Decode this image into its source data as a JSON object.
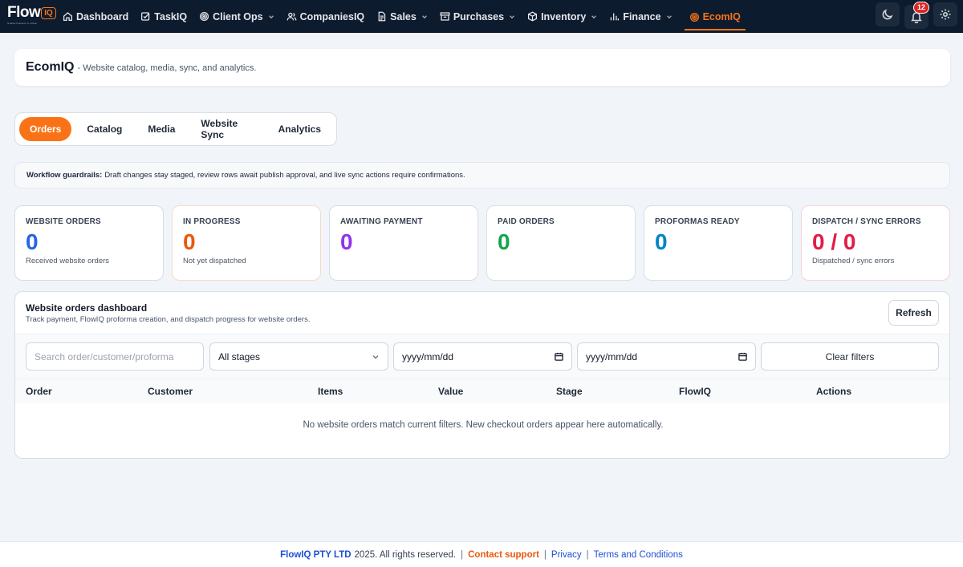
{
  "brand": {
    "word": "Flow",
    "suffix": "IQ",
    "tagline": "Smarter business, in motion"
  },
  "nav": {
    "items": [
      {
        "label": "Dashboard",
        "icon": "home-icon",
        "dropdown": false
      },
      {
        "label": "TaskIQ",
        "icon": "checkbox-icon",
        "dropdown": false
      },
      {
        "label": "Client Ops",
        "icon": "target-icon",
        "dropdown": true
      },
      {
        "label": "CompaniesIQ",
        "icon": "users-icon",
        "dropdown": false
      },
      {
        "label": "Sales",
        "icon": "document-icon",
        "dropdown": true
      },
      {
        "label": "Purchases",
        "icon": "archive-icon",
        "dropdown": true
      },
      {
        "label": "Inventory",
        "icon": "package-icon",
        "dropdown": true
      },
      {
        "label": "Finance",
        "icon": "bar-chart-icon",
        "dropdown": true
      },
      {
        "label": "EcomIQ",
        "icon": "target-icon",
        "dropdown": false,
        "active": true
      }
    ],
    "notifications_count": "12",
    "accent_color": "#f97316"
  },
  "header": {
    "title": "EcomIQ",
    "subtitle": "- Website catalog, media, sync, and analytics."
  },
  "tabs": [
    "Orders",
    "Catalog",
    "Media",
    "Website Sync",
    "Analytics"
  ],
  "active_tab": "Orders",
  "guardrails": {
    "label": "Workflow guardrails:",
    "text": "Draft changes stay staged, review rows await publish approval, and live sync actions require confirmations."
  },
  "stats": [
    {
      "label": "WEBSITE ORDERS",
      "value": "0",
      "desc": "Received website orders",
      "color": "#2563eb",
      "border": "#d6dde6"
    },
    {
      "label": "IN PROGRESS",
      "value": "0",
      "desc": "Not yet dispatched",
      "color": "#ea580c",
      "border": "#f5dcc4"
    },
    {
      "label": "AWAITING PAYMENT",
      "value": "0",
      "desc": "",
      "color": "#9333ea",
      "border": "#d6dde6"
    },
    {
      "label": "PAID ORDERS",
      "value": "0",
      "desc": "",
      "color": "#16a34a",
      "border": "#cfe8da"
    },
    {
      "label": "PROFORMAS READY",
      "value": "0",
      "desc": "",
      "color": "#0284c7",
      "border": "#cfe2ee"
    },
    {
      "label": "DISPATCH / SYNC ERRORS",
      "value": "0 / 0",
      "desc": "Dispatched / sync errors",
      "color": "#e11d48",
      "border": "#f3d3da"
    }
  ],
  "orders": {
    "title": "Website orders dashboard",
    "subtitle": "Track payment, FlowIQ proforma creation, and dispatch progress for website orders.",
    "refresh_label": "Refresh",
    "search_placeholder": "Search order/customer/proforma",
    "stage_value": "All stages",
    "date_from": "yyyy/mm/dd",
    "date_to": "yyyy/mm/dd",
    "clear_label": "Clear filters",
    "columns": [
      "Order",
      "Customer",
      "Items",
      "Value",
      "Stage",
      "FlowIQ",
      "Actions"
    ],
    "empty_text": "No website orders match current filters. New checkout orders appear here automatically."
  },
  "footer": {
    "company": "FlowIQ PTY LTD",
    "rights": "2025. All rights reserved.",
    "contact": "Contact support",
    "privacy": "Privacy",
    "terms": "Terms and Conditions"
  }
}
